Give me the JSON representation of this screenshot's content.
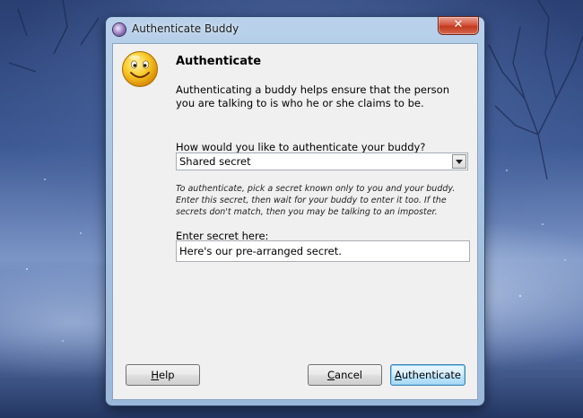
{
  "window": {
    "title": "Authenticate Buddy",
    "close_glyph": "✕"
  },
  "dialog": {
    "icon": "smiley-face-icon",
    "heading": "Authenticate",
    "intro": "Authenticating a buddy helps ensure that the person you are talking to is who he or she claims to be.",
    "question": "How would you like to authenticate your buddy?",
    "method_selected": "Shared secret",
    "hint": "To authenticate, pick a secret known only to you and your buddy.  Enter this secret, then wait for your buddy to enter it too.  If the secrets don't match, then you may be talking to an imposter.",
    "secret_label": "Enter secret here:",
    "secret_value": "Here's our pre-arranged secret."
  },
  "buttons": {
    "help": {
      "accel": "H",
      "rest": "elp"
    },
    "cancel": {
      "accel": "C",
      "rest": "ancel"
    },
    "authenticate": {
      "accel": "A",
      "rest": "uthenticate"
    }
  },
  "colors": {
    "client_bg": "#f0f0f0",
    "title_glass": "#b9d1ea",
    "close_red": "#c23a1f",
    "default_button_border": "#3c7fb1"
  }
}
